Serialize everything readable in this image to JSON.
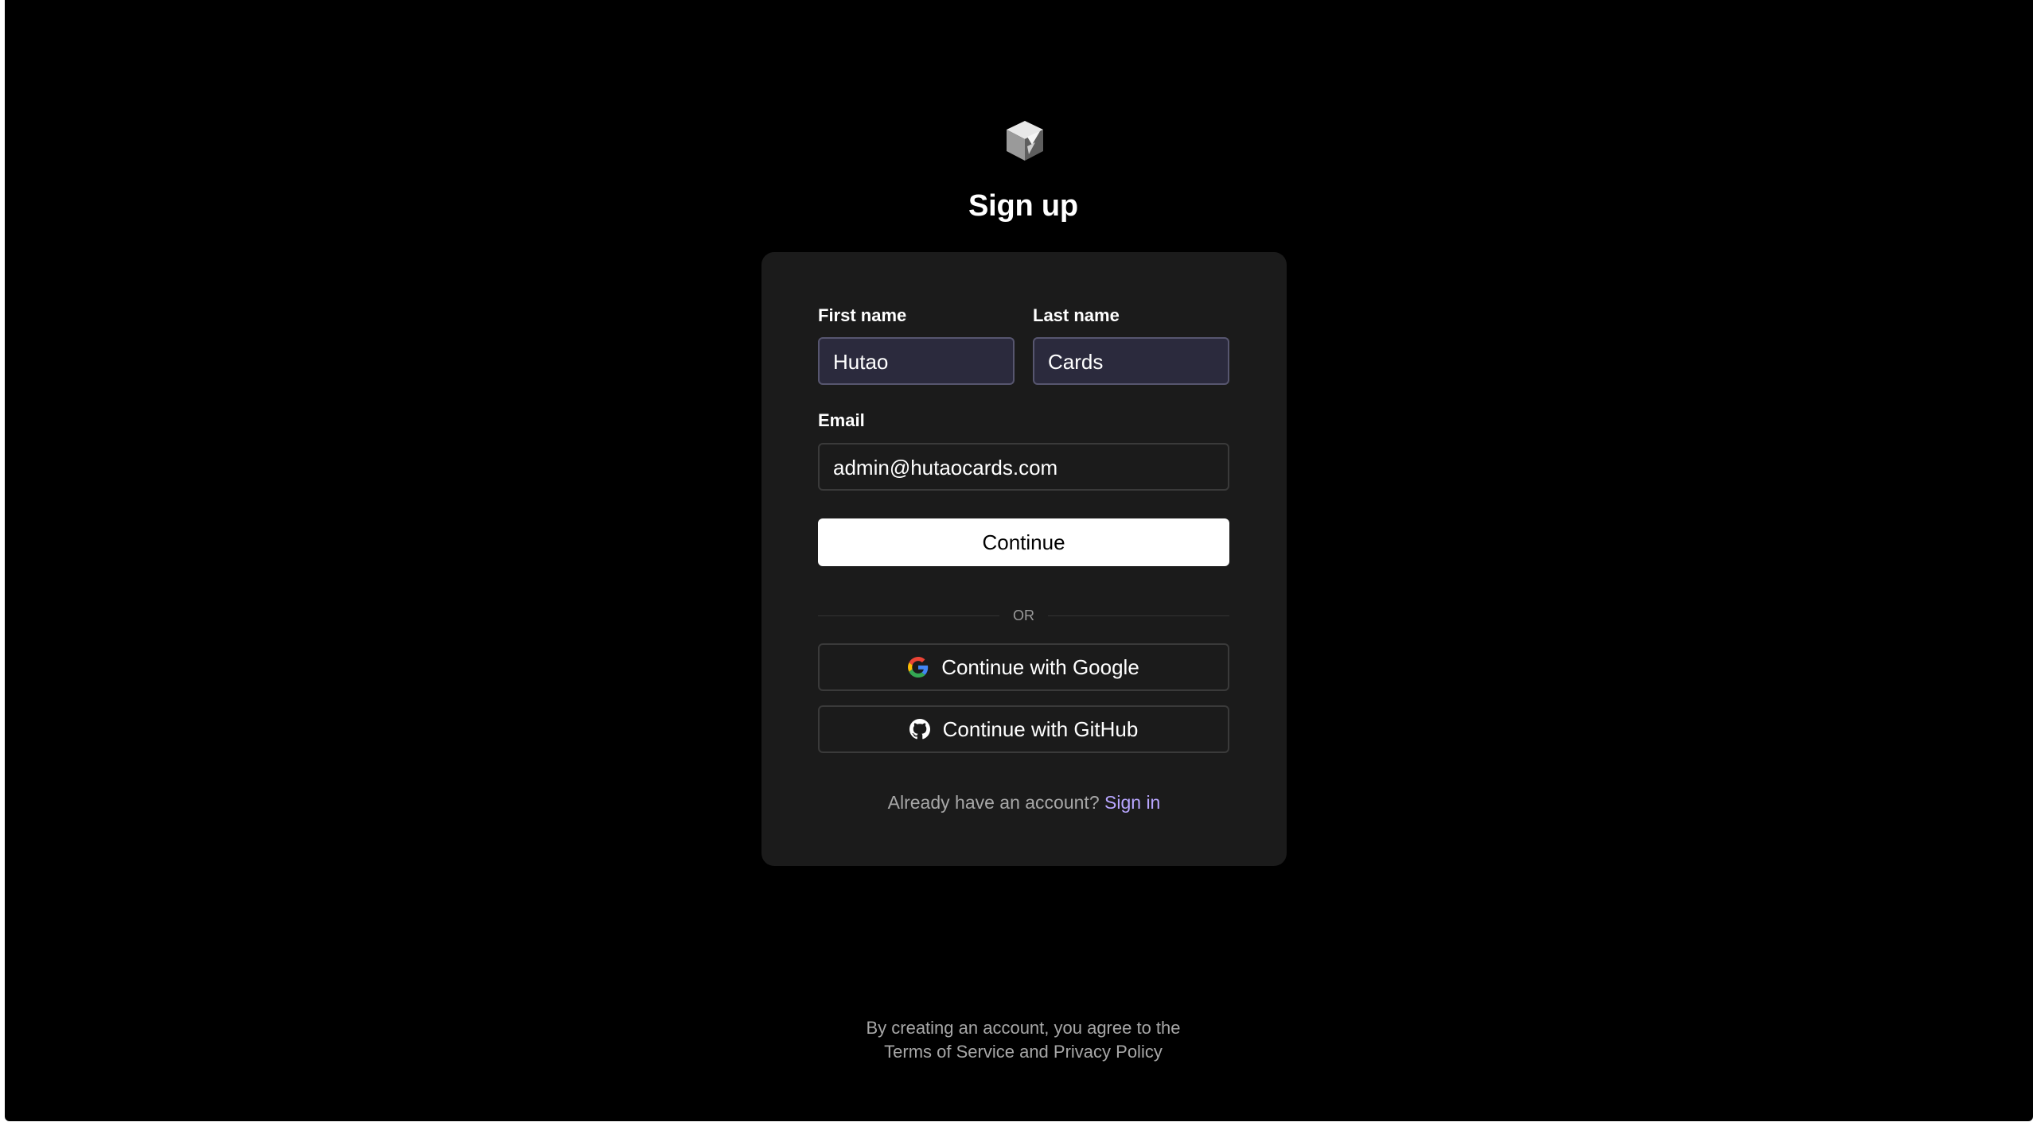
{
  "page": {
    "title": "Sign up"
  },
  "form": {
    "first_name_label": "First name",
    "first_name_value": "Hutao",
    "last_name_label": "Last name",
    "last_name_value": "Cards",
    "email_label": "Email",
    "email_value": "admin@hutaocards.com",
    "continue_label": "Continue",
    "divider_text": "OR",
    "google_label": "Continue with Google",
    "github_label": "Continue with GitHub",
    "account_prompt": "Already have an account?",
    "signin_link": "Sign in"
  },
  "footer": {
    "line1": "By creating an account, you agree to the",
    "line2": "Terms of Service and Privacy Policy"
  },
  "icons": {
    "logo": "cube-logo",
    "google": "google-icon",
    "github": "github-icon"
  },
  "colors": {
    "background": "#000000",
    "card": "#1b1b1b",
    "autofill_input": "#2b2a3d",
    "link": "#b8a6ff",
    "primary_button": "#ffffff"
  }
}
